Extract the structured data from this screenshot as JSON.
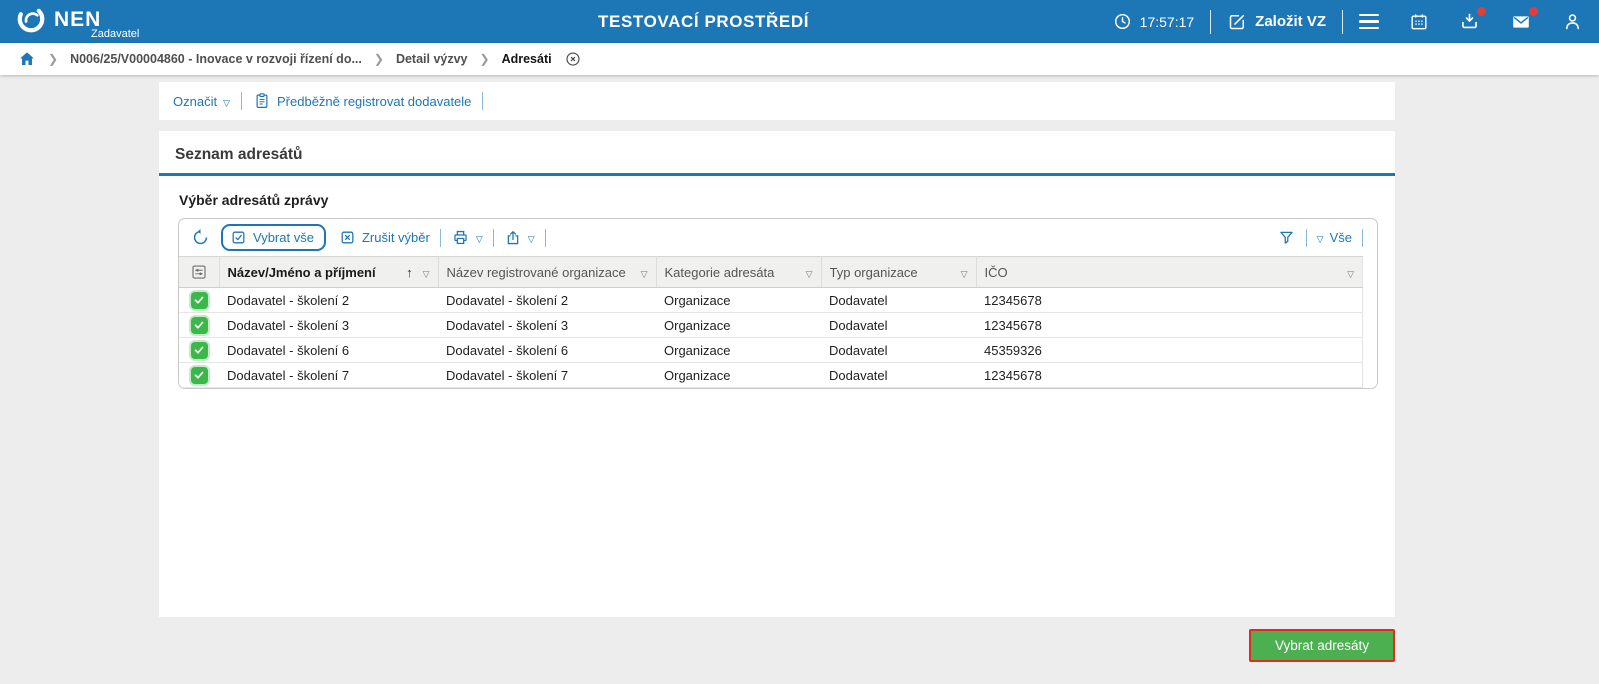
{
  "header": {
    "brand": "NEN",
    "brand_role": "Zadavatel",
    "environment_title": "TESTOVACÍ PROSTŘEDÍ",
    "clock": "17:57:17",
    "create_button_label": "Založit VZ"
  },
  "breadcrumb": {
    "items": [
      "N006/25/V00004860 - Inovace v rozvoji řízení do...",
      "Detail výzvy",
      "Adresáti"
    ]
  },
  "action_bar": {
    "mark_label": "Označit",
    "preregister_label": "Předběžně registrovat dodavatele"
  },
  "main": {
    "section_title": "Seznam adresátů",
    "subsection_title": "Výběr adresátů zprávy",
    "toolbar": {
      "select_all_label": "Vybrat vše",
      "clear_selection_label": "Zrušit výběr",
      "filter_scope_label": "Vše"
    },
    "table": {
      "columns": {
        "name": "Název/Jméno a příjmení",
        "org": "Název registrované organizace",
        "category": "Kategorie adresáta",
        "type": "Typ organizace",
        "ico": "IČO"
      },
      "rows": [
        {
          "name": "Dodavatel - školení 2",
          "org": "Dodavatel - školení 2",
          "category": "Organizace",
          "type": "Dodavatel",
          "ico": "12345678"
        },
        {
          "name": "Dodavatel - školení 3",
          "org": "Dodavatel - školení 3",
          "category": "Organizace",
          "type": "Dodavatel",
          "ico": "12345678"
        },
        {
          "name": "Dodavatel - školení 6",
          "org": "Dodavatel - školení 6",
          "category": "Organizace",
          "type": "Dodavatel",
          "ico": "45359326"
        },
        {
          "name": "Dodavatel - školení 7",
          "org": "Dodavatel - školení 7",
          "category": "Organizace",
          "type": "Dodavatel",
          "ico": "12345678"
        }
      ]
    }
  },
  "footer": {
    "select_button_label": "Vybrat adresáty"
  },
  "colors": {
    "header_blue": "#1d76b5",
    "link_blue": "#1d76b5",
    "button_green": "#4caf50",
    "button_border_red": "#e02b20",
    "badge_red": "#e23d3d",
    "checkbox_green": "#3cb84a"
  }
}
